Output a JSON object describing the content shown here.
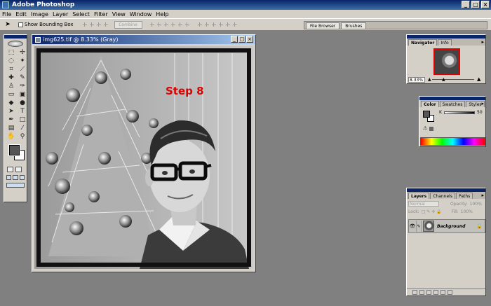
{
  "app": {
    "title": "Adobe Photoshop"
  },
  "menu": [
    "File",
    "Edit",
    "Image",
    "Layer",
    "Select",
    "Filter",
    "View",
    "Window",
    "Help"
  ],
  "options": {
    "show_bounding_box": "Show Bounding Box",
    "combine": "Combine"
  },
  "well": {
    "tabs": [
      "File Browser",
      "Brushes"
    ]
  },
  "document": {
    "title": "img625.tif @ 8.33% (Gray)",
    "overlay_label": "Step 8"
  },
  "navigator": {
    "tabs": [
      "Navigator",
      "Info"
    ],
    "zoom": "8.33%"
  },
  "color_palette": {
    "tabs": [
      "Color",
      "Swatches",
      "Styles"
    ],
    "channel": "K",
    "value": "50"
  },
  "layers_palette": {
    "tabs": [
      "Layers",
      "Channels",
      "Paths"
    ],
    "blend_mode": "Normal",
    "opacity_label": "Opacity:",
    "opacity": "100%",
    "lock_label": "Lock:",
    "fill_label": "Fill:",
    "fill": "100%",
    "layer_name": "Background"
  },
  "colors": {
    "title_bar": "#0a246a",
    "chrome": "#d4d0c8",
    "workspace": "#808080",
    "step_label": "#e00000"
  }
}
